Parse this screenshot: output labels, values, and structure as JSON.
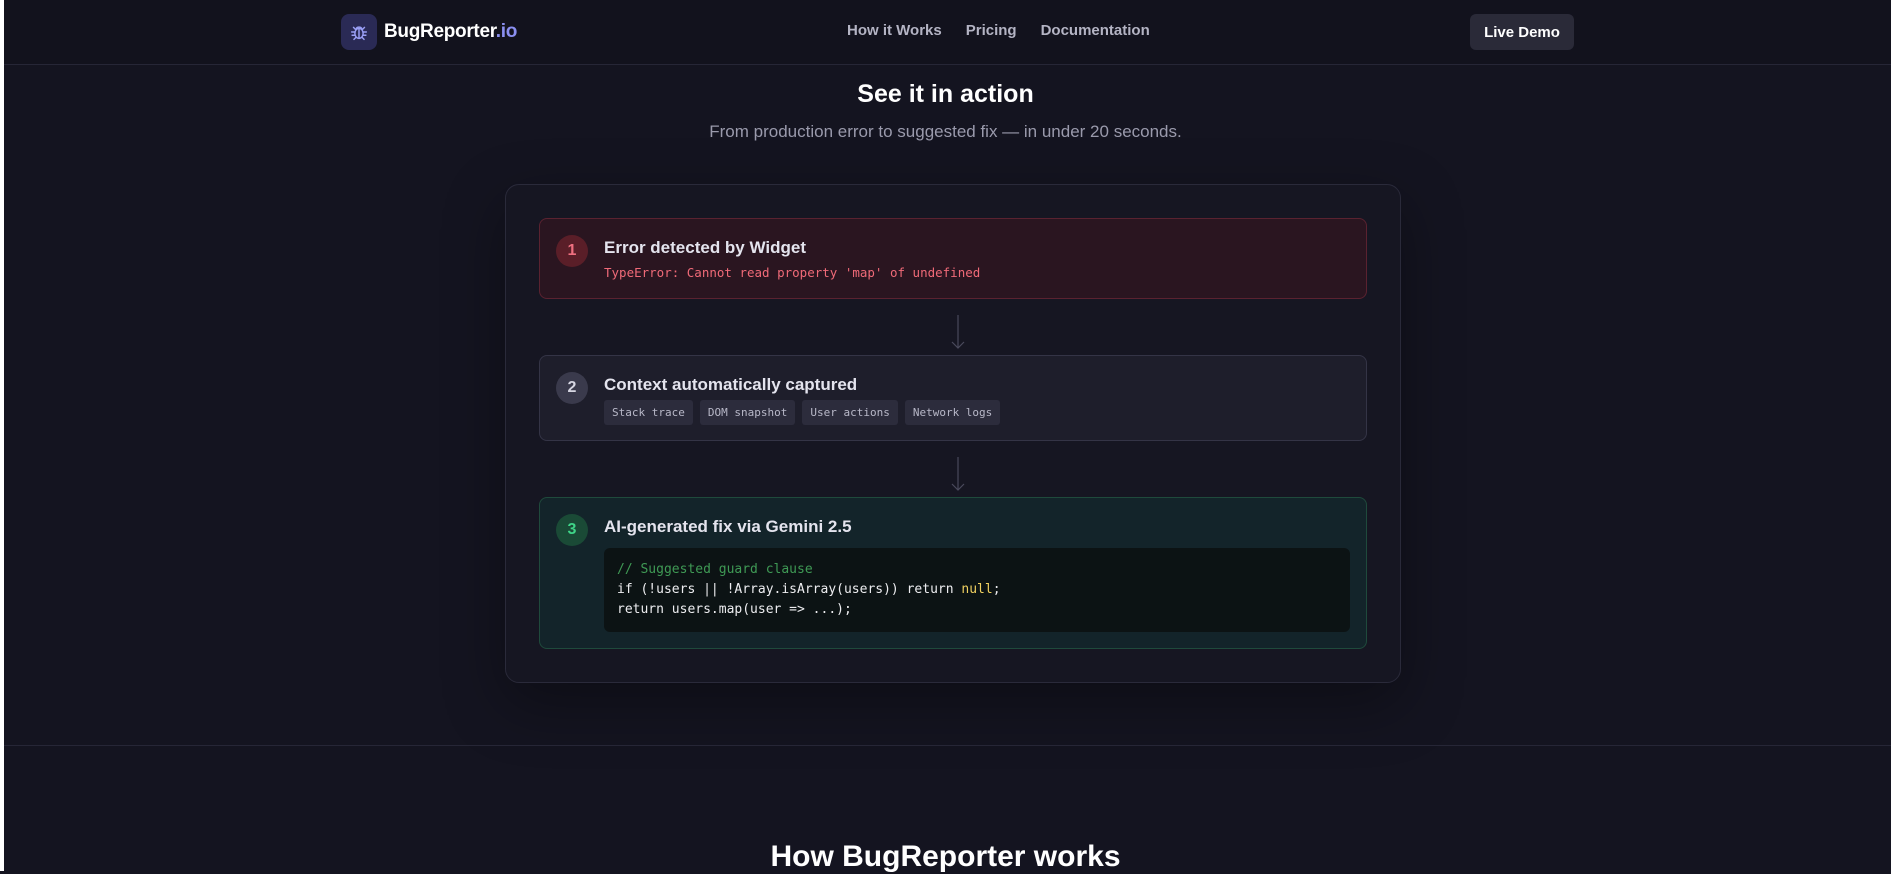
{
  "header": {
    "logo_name": "BugReporter",
    "logo_suffix": ".io",
    "nav": [
      "How it Works",
      "Pricing",
      "Documentation"
    ],
    "cta_label": "Live Demo"
  },
  "demo": {
    "title": "See it in action",
    "subtitle": "From production error to suggested fix — in under 20 seconds.",
    "steps": [
      {
        "number": "1",
        "title": "Error detected by Widget",
        "detail": "TypeError: Cannot read property 'map' of undefined"
      },
      {
        "number": "2",
        "title": "Context automatically captured",
        "tags": [
          "Stack trace",
          "DOM snapshot",
          "User actions",
          "Network logs"
        ]
      },
      {
        "number": "3",
        "title": "AI-generated fix via Gemini 2.5",
        "code": {
          "comment": "// Suggested guard clause",
          "line1_a": "if (!users || !Array.isArray(users)) return ",
          "line1_null": "null",
          "line1_b": ";",
          "line2": "return users.map(user => ...);"
        }
      }
    ]
  },
  "next_section": {
    "title": "How BugReporter works"
  },
  "colors": {
    "accent": "#8a8ff0",
    "error": "#f06a78",
    "success": "#3fd588",
    "background": "#141420"
  },
  "icons": {
    "logo": "bug-icon",
    "connector": "arrow-down-icon"
  }
}
